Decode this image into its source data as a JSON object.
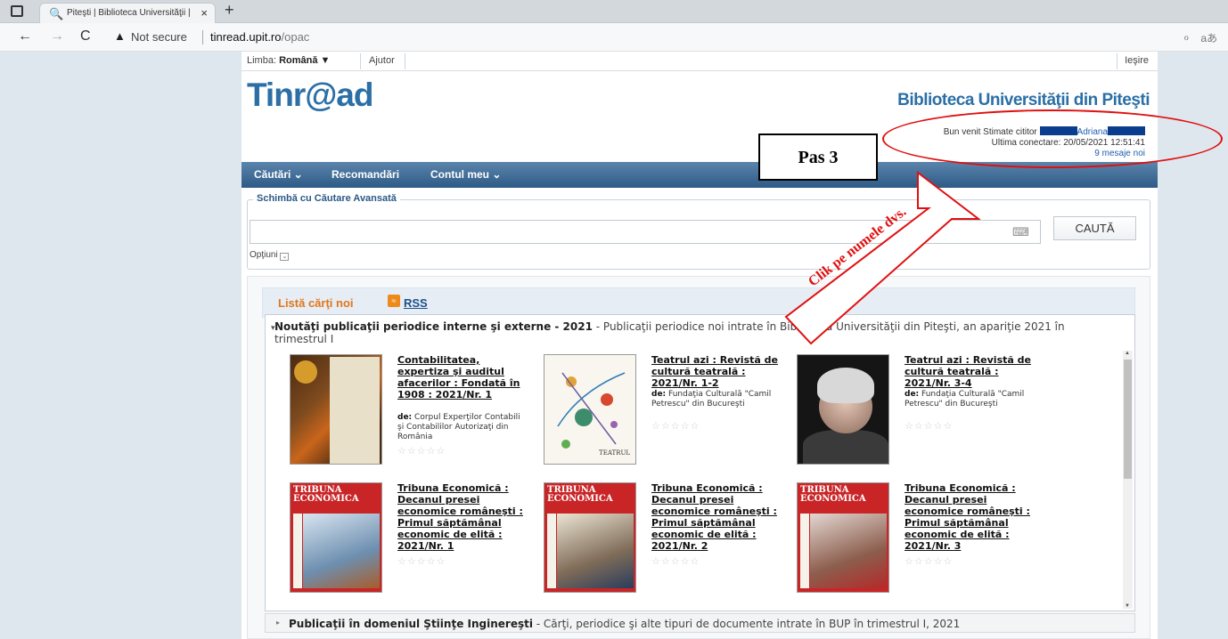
{
  "browser": {
    "tab_title": "Piteşti | Biblioteca Universităţii |",
    "close_glyph": "×",
    "new_tab_glyph": "+",
    "not_secure": "Not secure",
    "url_host": "tinread.upit.ro",
    "url_path": "/opac",
    "back_glyph": "←",
    "forward_glyph": "→",
    "reload_glyph": "C",
    "warn_glyph": "▲",
    "right_icon1": "ℴ",
    "right_icon2": "aあ"
  },
  "header": {
    "language_label": "Limba:",
    "language_value": "Română ▼",
    "help": "Ajutor",
    "logout": "Ieşire",
    "logo": "Tinr@ad",
    "library_name": "Biblioteca Universităţii din Piteşti",
    "welcome": "Bun venit Stimate cititor",
    "user_name": "Adriana",
    "last_login": "Ultima conectare: 20/05/2021 12:51:41",
    "messages": "9 mesaje noi"
  },
  "nav": {
    "items": [
      "Căutări ⌄",
      "Recomandări",
      "Contul meu ⌄"
    ]
  },
  "search": {
    "legend": "Schimbă cu  Căutare Avansată",
    "input_value": "",
    "button": "CAUTĂ",
    "keyboard_icon": "⌨",
    "options": "Opţiuni",
    "options_box": "⌄"
  },
  "books": {
    "title": "Listă cărţi noi",
    "rss_icon": "≈",
    "rss": "RSS",
    "section1_arrow": "▾",
    "section1_title": "Noutăţi publicaţii periodice interne şi externe - 2021",
    "section1_desc": " - Publicaţii periodice noi intrate în Biblioteca Universităţii din Piteşti, an apariţie 2021 în trimestrul I",
    "stars": "☆☆☆☆☆",
    "author_prefix": "de:",
    "items": [
      {
        "title": "Contabilitatea, expertiza şi auditul afacerilor : Fondată în 1908 : 2021/Nr. 1",
        "author": "Corpul Experţilor Contabili şi Contabililor Autorizaţi din România"
      },
      {
        "title": "Teatrul azi : Revistă de cultură teatrală : 2021/Nr. 1-2",
        "author": "Fundaţia Culturală \"Camil Petrescu\" din Bucureşti"
      },
      {
        "title": "Teatrul azi : Revistă de cultură teatrală : 2021/Nr. 3-4",
        "author": "Fundaţia Culturală \"Camil Petrescu\" din Bucureşti"
      },
      {
        "title": "Tribuna Economică : Decanul presei economice româneşti : Primul săptămânal economic de elită : 2021/Nr. 1",
        "author": ""
      },
      {
        "title": "Tribuna Economică : Decanul presei economice româneşti : Primul săptămânal economic de elită : 2021/Nr. 2",
        "author": ""
      },
      {
        "title": "Tribuna Economică : Decanul presei economice româneşti : Primul săptămânal economic de elită : 2021/Nr. 3",
        "author": ""
      }
    ],
    "cover_tribuna": "TRIBUNA ECONOMICA",
    "cover_teatru": "TEATRUL",
    "section2_arrow": "▸",
    "section2_title": "Publicaţii în domeniul Ştiinţe Inginereşti",
    "section2_desc": " - Cărţi, periodice şi alte tipuri de documente intrate în BUP în trimestrul I, 2021"
  },
  "annotation": {
    "step": "Pas 3",
    "note": "Clik pe numele dvs."
  },
  "colors": {
    "accent": "#2b6fa6",
    "annotation": "#e01010",
    "books_title": "#e0771b"
  }
}
